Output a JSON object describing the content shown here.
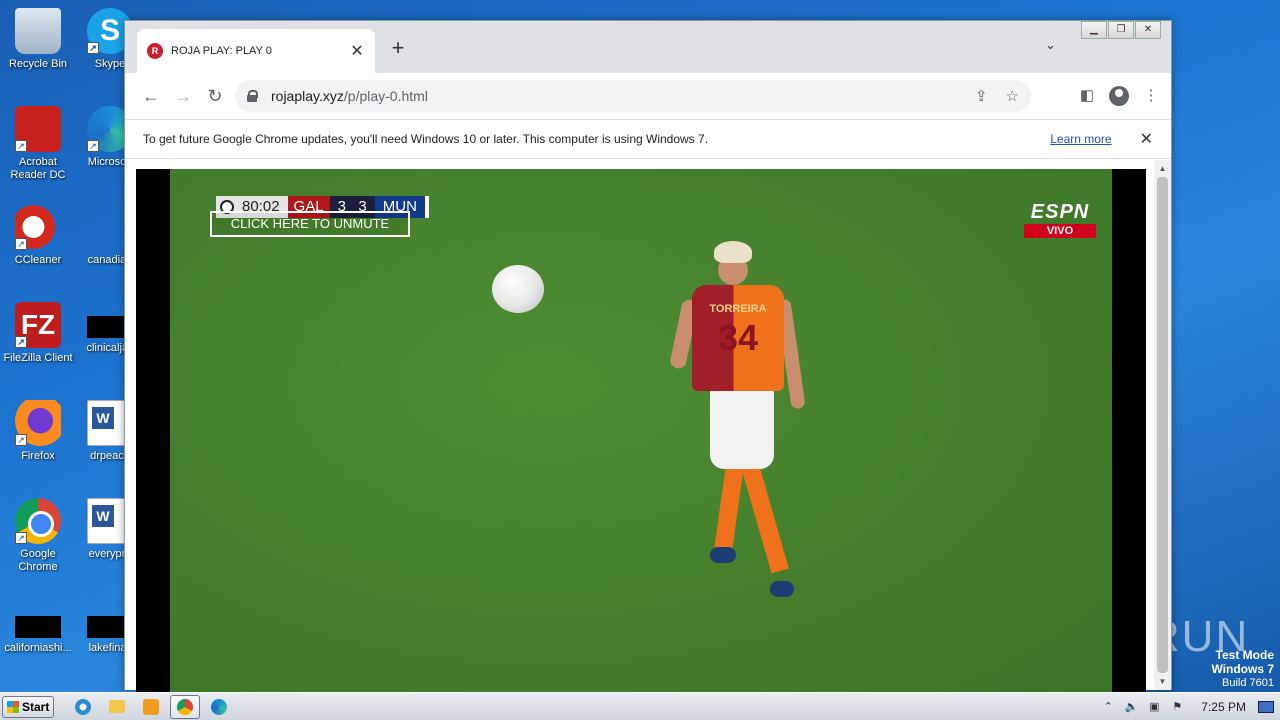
{
  "desktop": {
    "icons": [
      {
        "label": "Recycle Bin"
      },
      {
        "label": "Skype"
      },
      {
        "label": "Acrobat Reader DC"
      },
      {
        "label": "Microsoft"
      },
      {
        "label": "CCleaner"
      },
      {
        "label": "canadian"
      },
      {
        "label": "FileZilla Client"
      },
      {
        "label": "clinicaljac"
      },
      {
        "label": "Firefox"
      },
      {
        "label": "drpeace"
      },
      {
        "label": "Google Chrome"
      },
      {
        "label": "everypre"
      },
      {
        "label": "californiashi..."
      },
      {
        "label": "lakefinall"
      }
    ],
    "watermark": "ANY RUN",
    "test_mode": {
      "line1": "Test Mode",
      "line2": "Windows 7",
      "line3": "Build 7601"
    }
  },
  "browser": {
    "tab": {
      "title": "ROJA PLAY: PLAY 0",
      "favicon_letter": "R"
    },
    "new_tab_symbol": "+",
    "url": {
      "domain": "rojaplay.xyz",
      "path": "/p/play-0.html"
    },
    "infobar": {
      "message": "To get future Google Chrome updates, you'll need Windows 10 or later. This computer is using Windows 7.",
      "learn_more": "Learn more"
    }
  },
  "video": {
    "scorebug": {
      "time": "80:02",
      "home": "GAL",
      "home_score": "3",
      "away_score": "3",
      "away": "MUN"
    },
    "unmute_label": "CLICK HERE TO UNMUTE",
    "broadcaster": {
      "logo": "ESPN",
      "tag": "VIVO"
    },
    "player": {
      "name": "TORREIRA",
      "number": "34"
    }
  },
  "taskbar": {
    "start_label": "Start",
    "clock": "7:25 PM"
  },
  "colors": {
    "link": "#1a56c9",
    "home_team": "#b01818",
    "away_team": "#123a8c",
    "espn_red": "#d0021b"
  }
}
